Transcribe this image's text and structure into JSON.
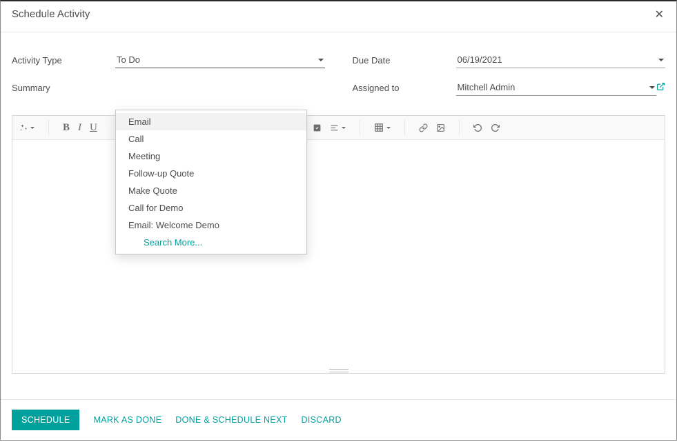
{
  "dialog": {
    "title": "Schedule Activity"
  },
  "fields": {
    "activity_type": {
      "label": "Activity Type",
      "value": "To Do"
    },
    "summary": {
      "label": "Summary",
      "value": ""
    },
    "due_date": {
      "label": "Due Date",
      "value": "06/19/2021"
    },
    "assigned_to": {
      "label": "Assigned to",
      "value": "Mitchell Admin"
    }
  },
  "activity_type_options": [
    "Email",
    "Call",
    "Meeting",
    "Follow-up Quote",
    "Make Quote",
    "Call for Demo",
    "Email: Welcome Demo"
  ],
  "activity_type_search_more": "Search More...",
  "footer": {
    "schedule": "SCHEDULE",
    "mark_done": "MARK AS DONE",
    "done_next": "DONE & SCHEDULE NEXT",
    "discard": "DISCARD"
  }
}
